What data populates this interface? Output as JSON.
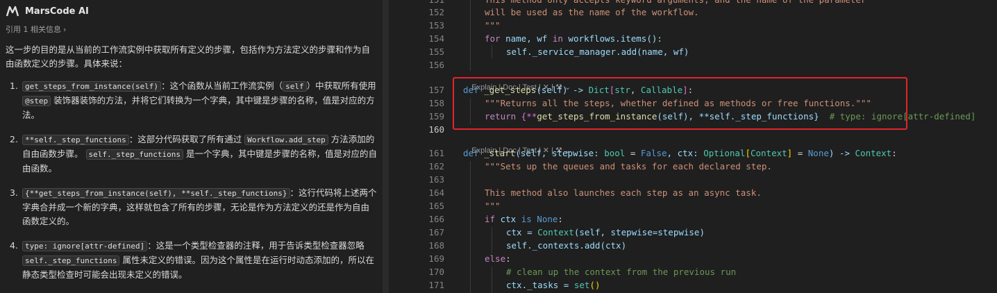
{
  "chat": {
    "app_title": "MarsCode AI",
    "ref_text": "引用 1 相关信息",
    "ref_chevron": "›",
    "intro": "这一步的目的是从当前的工作流实例中获取所有定义的步骤，包括作为方法定义的步骤和作为自由函数定义的步骤。具体来说：",
    "points": [
      {
        "num": "1.",
        "code": "get_steps_from_instance(self)",
        "a": "：这个函数从当前工作流实例（",
        "code2": "self",
        "b": "）中获取所有使用",
        "code3": "@step",
        "c": "装饰器装饰的方法，并将它们转换为一个字典，其中键是步骤的名称，值是对应的方法。"
      },
      {
        "num": "2.",
        "code": "**self._step_functions",
        "a": "：这部分代码获取了所有通过",
        "code2": "Workflow.add_step",
        "b": "方法添加的自由函数步骤。",
        "code3": "self._step_functions",
        "c": "是一个字典，其中键是步骤的名称，值是对应的自由函数。"
      },
      {
        "num": "3.",
        "code": "{**get_steps_from_instance(self), **self._step_functions}",
        "a": "：这行代码将上述两个字典合并成一个新的字典，这样就包含了所有的步骤，无论是作为方法定义的还是作为自由函数定义的。"
      },
      {
        "num": "4.",
        "code": "type: ignore[attr-defined]",
        "a": "：这是一个类型检查器的注释，用于告诉类型检查器忽略",
        "code2": "self._step_functions",
        "b": "属性未定义的错误。因为这个属性是在运行时动态添加的，所以在静态类型检查时可能会出现未定义的错误。"
      }
    ]
  },
  "editor": {
    "lens_text": "Explain | Doc | Test | ✕ | ",
    "lens_icons": [
      "broom-icon",
      "chevron-down-icon"
    ],
    "lines": {
      "l151": {
        "n": "151",
        "text": "This method only accepts keyword arguments, and the name of the parameter"
      },
      "l152": {
        "n": "152",
        "text": "will be used as the name of the workflow."
      },
      "l153": {
        "n": "153",
        "text": "\"\"\""
      },
      "l154": {
        "n": "154",
        "a": "for",
        "b": " name, wf ",
        "c": "in",
        "d": " workflows.items():"
      },
      "l155": {
        "n": "155",
        "text": "self._service_manager.add(name, wf)"
      },
      "l156": {
        "n": "156"
      },
      "l157": {
        "n": "157",
        "a": "def",
        "b": " _get_steps",
        "c": "(self) -> ",
        "d": "Dict",
        "e": "[",
        "f": "str",
        "g": ", ",
        "h": "Callable",
        "i": "]",
        ":": ":"
      },
      "l158": {
        "n": "158",
        "text": "\"\"\"Returns all the steps, whether defined as methods or free functions.\"\"\""
      },
      "l159": {
        "n": "159",
        "a": "return",
        "b": " {**",
        "c": "get_steps_from_instance",
        "d": "(self), **self._step_functions}",
        "e": "  # type: ignore[attr-defined]"
      },
      "l160": {
        "n": "160"
      },
      "l161": {
        "n": "161",
        "a": "def",
        "b": " _start",
        "c": "(self, stepwise: ",
        "d": "bool",
        "e": " = ",
        "f": "False",
        "g": ", ctx: ",
        "h": "Optional",
        "i": "[",
        "j": "Context",
        "k": "]",
        "l": " = ",
        "m": "None",
        "o": ") -> ",
        "q": "Context",
        ":": ":"
      },
      "l162": {
        "n": "162",
        "text": "\"\"\"Sets up the queues and tasks for each declared step."
      },
      "l163": {
        "n": "163"
      },
      "l164": {
        "n": "164",
        "text": "This method also launches each step as an async task."
      },
      "l165": {
        "n": "165",
        "text": "\"\"\""
      },
      "l166": {
        "n": "166",
        "a": "if",
        "b": " ctx ",
        "c": "is",
        "d": " None",
        ":": ":"
      },
      "l167": {
        "n": "167",
        "a": "ctx = ",
        "b": "Context",
        "c": "(self, stepwise=stepwise)"
      },
      "l168": {
        "n": "168",
        "text": "self._contexts.add(ctx)"
      },
      "l169": {
        "n": "169",
        "a": "else",
        ":": ":"
      },
      "l170": {
        "n": "170",
        "text": "# clean up the context from the previous run"
      },
      "l171": {
        "n": "171",
        "a": "ctx._tasks = ",
        "b": "set",
        "c": "()"
      }
    }
  }
}
